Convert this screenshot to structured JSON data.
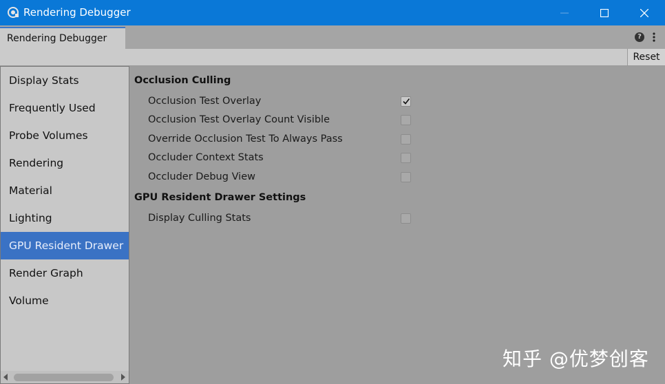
{
  "window": {
    "title": "Rendering Debugger",
    "app_icon": "unity-logo-icon",
    "controls": [
      "minimize-icon",
      "maximize-icon",
      "close-icon"
    ]
  },
  "tab": {
    "label": "Rendering Debugger",
    "help_icon": "help-icon",
    "menu_icon": "kebab-menu-icon"
  },
  "toolbar": {
    "reset_label": "Reset"
  },
  "sidebar": {
    "items": [
      {
        "label": "Display Stats"
      },
      {
        "label": "Frequently Used"
      },
      {
        "label": "Probe Volumes"
      },
      {
        "label": "Rendering"
      },
      {
        "label": "Material"
      },
      {
        "label": "Lighting"
      },
      {
        "label": "GPU Resident Drawer",
        "selected": true
      },
      {
        "label": "Render Graph"
      },
      {
        "label": "Volume"
      }
    ]
  },
  "main": {
    "sections": [
      {
        "title": "Occlusion Culling",
        "rows": [
          {
            "label": "Occlusion Test Overlay",
            "checked": true
          },
          {
            "label": "Occlusion Test Overlay Count Visible",
            "checked": false
          },
          {
            "label": "Override Occlusion Test To Always Pass",
            "checked": false
          },
          {
            "label": "Occluder Context Stats",
            "checked": false
          },
          {
            "label": "Occluder Debug View",
            "checked": false
          }
        ]
      },
      {
        "title": "GPU Resident Drawer Settings",
        "rows": [
          {
            "label": "Display Culling Stats",
            "checked": false
          }
        ]
      }
    ]
  },
  "watermark": "知乎 @优梦创客",
  "colors": {
    "titlebar": "#0a78d7",
    "selected_item": "#3a72c4",
    "panel": "#9e9e9e"
  }
}
